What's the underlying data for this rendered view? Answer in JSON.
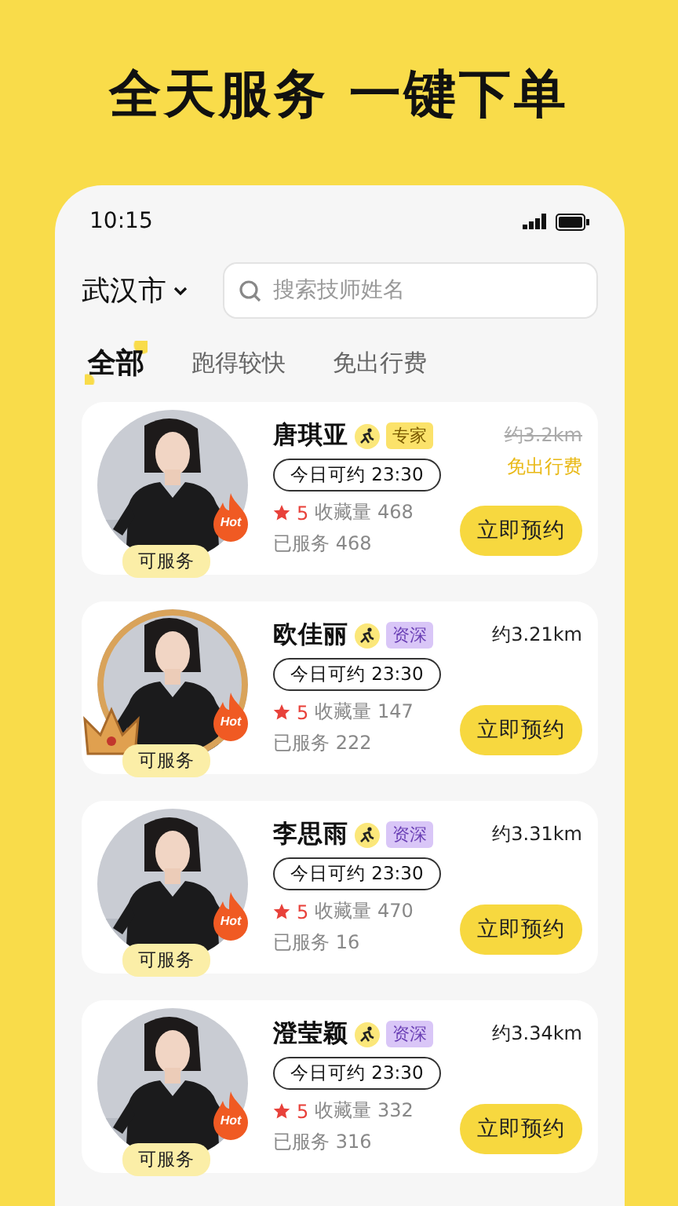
{
  "headline": "全天服务 一键下单",
  "status_bar": {
    "time": "10:15"
  },
  "city": {
    "label": "武汉市"
  },
  "search": {
    "placeholder": "搜索技师姓名"
  },
  "tabs": [
    {
      "label": "全部",
      "selected": true
    },
    {
      "label": "跑得较快",
      "selected": false
    },
    {
      "label": "免出行费",
      "selected": false
    }
  ],
  "technicians": [
    {
      "name": "唐琪亚",
      "badge": {
        "label": "专家",
        "kind": "expert"
      },
      "availability": "今日可约 23:30",
      "rating": "5",
      "favorites": "收藏量 468",
      "served": "已服务 468",
      "distance": "约3.2km",
      "distance_struck": true,
      "fee_note": "免出行费",
      "crowned": false,
      "hot": "Hot",
      "status": "可服务",
      "button": "立即预约"
    },
    {
      "name": "欧佳丽",
      "badge": {
        "label": "资深",
        "kind": "senior"
      },
      "availability": "今日可约 23:30",
      "rating": "5",
      "favorites": "收藏量 147",
      "served": "已服务 222",
      "distance": "约3.21km",
      "distance_struck": false,
      "crowned": true,
      "hot": "Hot",
      "status": "可服务",
      "button": "立即预约"
    },
    {
      "name": "李思雨",
      "badge": {
        "label": "资深",
        "kind": "senior"
      },
      "availability": "今日可约 23:30",
      "rating": "5",
      "favorites": "收藏量 470",
      "served": "已服务 16",
      "distance": "约3.31km",
      "distance_struck": false,
      "crowned": false,
      "hot": "Hot",
      "status": "可服务",
      "button": "立即预约"
    },
    {
      "name": "澄莹颖",
      "badge": {
        "label": "资深",
        "kind": "senior"
      },
      "availability": "今日可约 23:30",
      "rating": "5",
      "favorites": "收藏量 332",
      "served": "已服务 316",
      "distance": "约3.34km",
      "distance_struck": false,
      "crowned": false,
      "hot": "Hot",
      "status": "可服务",
      "button": "立即预约"
    }
  ]
}
